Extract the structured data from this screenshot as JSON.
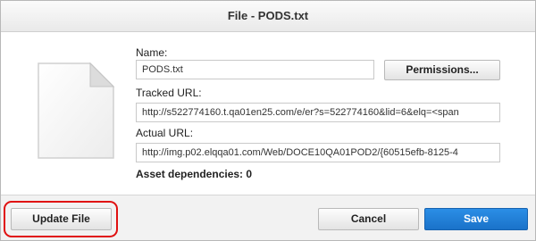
{
  "window": {
    "title": "File - PODS.txt"
  },
  "form": {
    "name_label": "Name:",
    "name_value": "PODS.txt",
    "permissions_button": "Permissions...",
    "tracked_url_label": "Tracked URL:",
    "tracked_url_value": "http://s522774160.t.qa01en25.com/e/er?s=522774160&lid=6&elq=<span",
    "actual_url_label": "Actual URL:",
    "actual_url_value": "http://img.p02.elqqa01.com/Web/DOCE10QA01POD2/{60515efb-8125-4",
    "asset_dependencies": "Asset dependencies: 0"
  },
  "footer": {
    "update_file": "Update File",
    "cancel": "Cancel",
    "save": "Save"
  },
  "icons": {
    "file": "document-file-icon"
  },
  "colors": {
    "primary": "#1a72c9",
    "highlight": "#e01010"
  }
}
